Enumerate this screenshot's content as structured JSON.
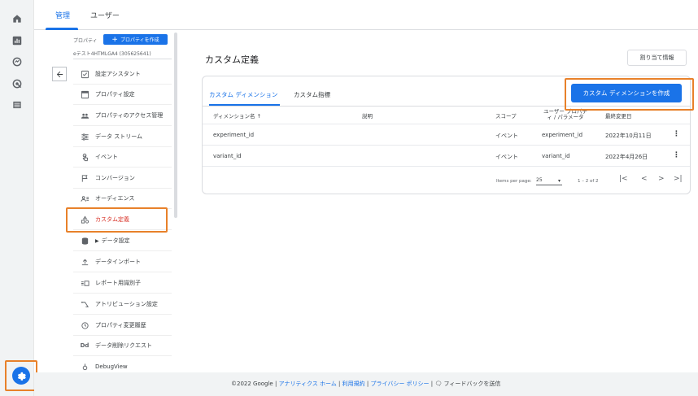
{
  "top_tabs": {
    "admin": "管理",
    "user": "ユーザー"
  },
  "admin_nav": {
    "property_label": "プロパティ",
    "create_property": "プロパティを作成",
    "property_name": "eテスト4HTMLGA4 (305625641)",
    "items": [
      {
        "label": "設定アシスタント",
        "icon": "checkbox-icon"
      },
      {
        "label": "プロパティ設定",
        "icon": "property-settings-icon"
      },
      {
        "label": "プロパティのアクセス管理",
        "icon": "people-icon"
      },
      {
        "label": "データ ストリーム",
        "icon": "data-stream-icon"
      },
      {
        "label": "イベント",
        "icon": "touch-icon"
      },
      {
        "label": "コンバージョン",
        "icon": "flag-icon"
      },
      {
        "label": "オーディエンス",
        "icon": "audience-icon"
      },
      {
        "label": "カスタム定義",
        "icon": "shapes-icon"
      },
      {
        "label": "データ設定",
        "icon": "database-icon"
      },
      {
        "label": "データインポート",
        "icon": "upload-icon"
      },
      {
        "label": "レポート用識別子",
        "icon": "identity-icon"
      },
      {
        "label": "アトリビューション設定",
        "icon": "attribution-icon"
      },
      {
        "label": "プロパティ変更履歴",
        "icon": "history-icon"
      },
      {
        "label": "データ削除リクエスト",
        "icon": "dd-icon"
      },
      {
        "label": "DebugView",
        "icon": "debug-icon"
      }
    ]
  },
  "main": {
    "title": "カスタム定義",
    "assign_button": "割り当て情報",
    "create_button": "カスタム ディメンションを作成",
    "tabs": [
      "カスタム ディメンション",
      "カスタム指標"
    ],
    "columns": [
      "ディメンション名 ↑",
      "説明",
      "スコープ",
      "ユーザー プロパティ / パラメータ",
      "最終変更日"
    ],
    "rows": [
      {
        "name": "experiment_id",
        "description": "",
        "scope": "イベント",
        "param": "experiment_id",
        "modified": "2022年10月11日"
      },
      {
        "name": "variant_id",
        "description": "",
        "scope": "イベント",
        "param": "variant_id",
        "modified": "2022年4月26日"
      }
    ],
    "pager": {
      "label": "Items per page:",
      "size": "25",
      "range": "1 – 2 of 2",
      "first": "|<",
      "prev": "<",
      "next": ">",
      "last": ">|"
    }
  },
  "footer": {
    "copyright": "©2022 Google",
    "analytics_home": "アナリティクス ホーム",
    "terms": "利用規約",
    "privacy": "プライバシー ポリシー",
    "feedback": "フィードバックを送信"
  },
  "colors": {
    "accent": "#1a73e8",
    "highlight": "#e8812a",
    "active_nav": "#d93025"
  }
}
